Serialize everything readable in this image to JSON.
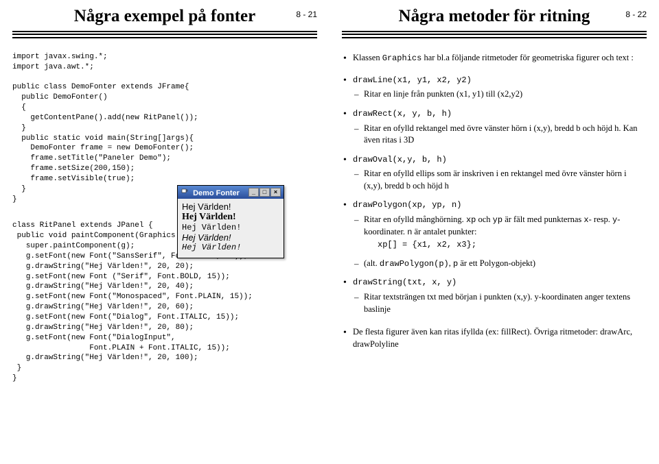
{
  "left": {
    "title": "Några exempel på fonter",
    "page": "8 - 21",
    "code_top": "import javax.swing.*;\nimport java.awt.*;\n\npublic class DemoFonter extends JFrame{\n  public DemoFonter()\n  {\n    getContentPane().add(new RitPanel());\n  }\n  public static void main(String[]args){\n    DemoFonter frame = new DemoFonter();\n    frame.setTitle(\"Paneler Demo\");\n    frame.setSize(200,150);\n    frame.setVisible(true);\n  }\n}",
    "code_bottom": "class RitPanel extends JPanel {\n public void paintComponent(Graphics g){\n   super.paintComponent(g);\n   g.setFont(new Font(\"SansSerif\", Font.PLAIN, 15));\n   g.drawString(\"Hej Världen!\", 20, 20);\n   g.setFont(new Font (\"Serif\", Font.BOLD, 15));\n   g.drawString(\"Hej Världen!\", 20, 40);\n   g.setFont(new Font(\"Monospaced\", Font.PLAIN, 15));\n   g.drawString(\"Hej Världen!\", 20, 60);\n   g.setFont(new Font(\"Dialog\", Font.ITALIC, 15));\n   g.drawString(\"Hej Världen!\", 20, 80);\n   g.setFont(new Font(\"DialogInput\",\n                 Font.PLAIN + Font.ITALIC, 15));\n   g.drawString(\"Hej Världen!\", 20, 100);\n }\n}",
    "demo": {
      "title": "Demo Fonter",
      "l1": "Hej Världen!",
      "l2": "Hej Världen!",
      "l3": "Hej Världen!",
      "l4": "Hej Världen!",
      "l5": "Hej Världen!",
      "min": "_",
      "max": "□",
      "close": "×"
    }
  },
  "right": {
    "title": "Några metoder för ritning",
    "page": "8 - 22",
    "b1_pre": "Klassen ",
    "b1_code": "Graphics",
    "b1_post": " har bl.a följande ritmetoder för geometriska figurer och text :",
    "m1": "drawLine(x1, y1, x2, y2)",
    "m1_sub": "Ritar en linje från punkten (x1, y1) till (x2,y2)",
    "m2": "drawRect(x, y, b, h)",
    "m2_sub": "Ritar en ofylld rektangel med övre vänster hörn i (x,y), bredd b och höjd h. Kan även ritas i 3D",
    "m3": "drawOval(x,y, b, h)",
    "m3_sub": "Ritar en ofylld ellips som är inskriven i en rektangel med övre vänster hörn i (x,y), bredd b och höjd h",
    "m4": "drawPolygon(xp, yp, n)",
    "m4_sub_a": "Ritar en ofylld månghörning. ",
    "m4_xp": "xp",
    "m4_och": " och ",
    "m4_yp": "yp",
    "m4_sub_b": " är fält med punkternas ",
    "m4_x": "x",
    "m4_resp": "- resp. ",
    "m4_y": "y",
    "m4_koord": "-koordinater. ",
    "m4_n": "n",
    "m4_sub_c": " är antalet punkter:",
    "m4_code": "xp[] = {x1, x2, x3};",
    "m4_alt_a": "(alt. ",
    "m4_alt_code": "drawPolygon(p)",
    "m4_alt_b": ", ",
    "m4_alt_p": "p",
    "m4_alt_c": " är ett Polygon-objekt)",
    "m5": "drawString(txt, x, y)",
    "m5_sub": "Ritar textsträngen txt med början i punkten (x,y). y-koordinaten anger textens baslinje",
    "footer": "De flesta figurer även kan ritas ifyllda (ex: fillRect). Övriga ritmetoder: drawArc, drawPolyline"
  }
}
